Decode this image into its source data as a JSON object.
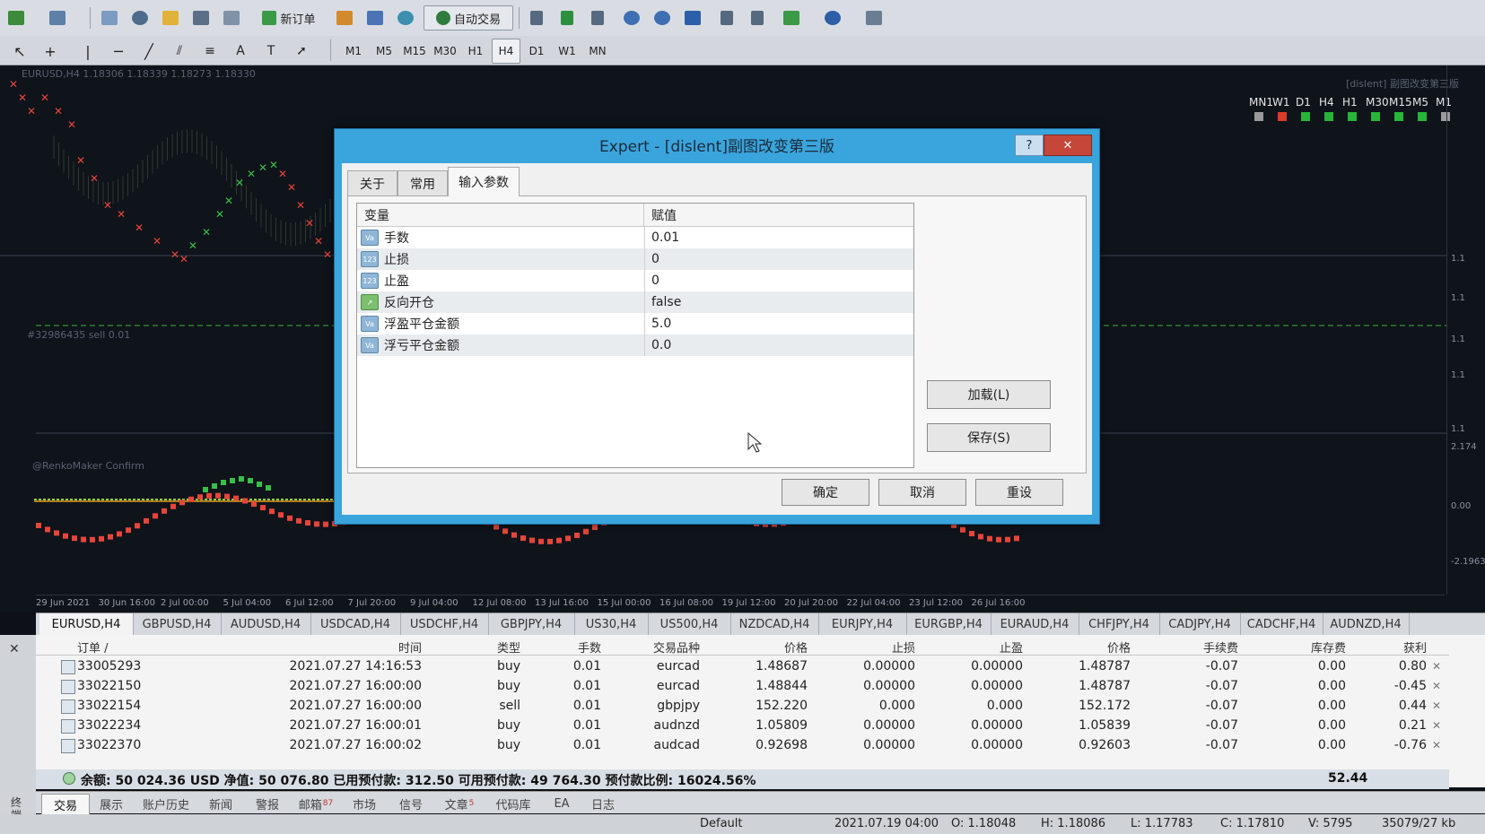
{
  "toolbar": {
    "new_order_label": "新订单",
    "auto_trading_label": "自动交易",
    "timeframes": [
      "M1",
      "M5",
      "M15",
      "M30",
      "H1",
      "H4",
      "D1",
      "W1",
      "MN"
    ],
    "active_timeframe": "H4"
  },
  "chart": {
    "info_line": "EURUSD,H4  1.18306 1.18339 1.18273 1.18330",
    "order_line_label": "#32986435 sell 0.01",
    "indicator_label": "@RenkoMaker Confirm",
    "top_right_label": "[dislent] 副图改变第三版",
    "tf_legend": [
      "MN1",
      "W1",
      "D1",
      "H4",
      "H1",
      "M30",
      "M15",
      "M5",
      "M1"
    ],
    "tf_legend_colors": [
      "#9a9a9a",
      "#d93a2b",
      "#27b43a",
      "#27b43a",
      "#27b43a",
      "#27b43a",
      "#27b43a",
      "#27b43a",
      "#9a9a9a"
    ],
    "x_labels": [
      "29 Jun 2021",
      "30 Jun 16:00",
      "2 Jul 00:00",
      "5 Jul 04:00",
      "6 Jul 12:00",
      "7 Jul 20:00",
      "9 Jul 04:00",
      "12 Jul 08:00",
      "13 Jul 16:00",
      "15 Jul 00:00",
      "16 Jul 08:00",
      "19 Jul 12:00",
      "20 Jul 20:00",
      "22 Jul 04:00",
      "23 Jul 12:00",
      "26 Jul 16:00"
    ],
    "price_labels": [
      "1.1",
      "1.1",
      "1.1",
      "1.1",
      "1.1",
      "2.174",
      "0.00",
      "-2.19635"
    ]
  },
  "dialog": {
    "title": "Expert - [dislent]副图改变第三版",
    "help": "?",
    "close": "✕",
    "tabs": [
      "关于",
      "常用",
      "输入参数"
    ],
    "selected_tab": "输入参数",
    "columns": [
      "变量",
      "赋值"
    ],
    "params": [
      {
        "icon": "Va",
        "name": "手数",
        "value": "0.01"
      },
      {
        "icon": "123",
        "name": "止损",
        "value": "0"
      },
      {
        "icon": "123",
        "name": "止盈",
        "value": "0"
      },
      {
        "icon": "bool",
        "name": "反向开仓",
        "value": "false"
      },
      {
        "icon": "Va",
        "name": "浮盈平仓金额",
        "value": "5.0"
      },
      {
        "icon": "Va",
        "name": "浮亏平仓金额",
        "value": "0.0"
      }
    ],
    "load_button": "加载(L)",
    "save_button": "保存(S)",
    "ok_button": "确定",
    "cancel_button": "取消",
    "reset_button": "重设"
  },
  "symbol_tabs": [
    "EURUSD,H4",
    "GBPUSD,H4",
    "AUDUSD,H4",
    "USDCAD,H4",
    "USDCHF,H4",
    "GBPJPY,H4",
    "US30,H4",
    "US500,H4",
    "NZDCAD,H4",
    "EURJPY,H4",
    "EURGBP,H4",
    "EURAUD,H4",
    "CHFJPY,H4",
    "CADJPY,H4",
    "CADCHF,H4",
    "AUDNZD,H4"
  ],
  "selected_symbol_tab": "EURUSD,H4",
  "terminal": {
    "headers": [
      "订单 /",
      "时间",
      "类型",
      "手数",
      "交易品种",
      "价格",
      "止损",
      "止盈",
      "价格",
      "手续费",
      "库存费",
      "获利"
    ],
    "orders": [
      {
        "ticket": "33005293",
        "time": "2021.07.27 14:16:53",
        "type": "buy",
        "lots": "0.01",
        "symbol": "eurcad",
        "price": "1.48687",
        "sl": "0.00000",
        "tp": "0.00000",
        "cur": "1.48787",
        "commission": "-0.07",
        "swap": "0.00",
        "profit": "0.80"
      },
      {
        "ticket": "33022150",
        "time": "2021.07.27 16:00:00",
        "type": "buy",
        "lots": "0.01",
        "symbol": "eurcad",
        "price": "1.48844",
        "sl": "0.00000",
        "tp": "0.00000",
        "cur": "1.48787",
        "commission": "-0.07",
        "swap": "0.00",
        "profit": "-0.45"
      },
      {
        "ticket": "33022154",
        "time": "2021.07.27 16:00:00",
        "type": "sell",
        "lots": "0.01",
        "symbol": "gbpjpy",
        "price": "152.220",
        "sl": "0.000",
        "tp": "0.000",
        "cur": "152.172",
        "commission": "-0.07",
        "swap": "0.00",
        "profit": "0.44"
      },
      {
        "ticket": "33022234",
        "time": "2021.07.27 16:00:01",
        "type": "buy",
        "lots": "0.01",
        "symbol": "audnzd",
        "price": "1.05809",
        "sl": "0.00000",
        "tp": "0.00000",
        "cur": "1.05839",
        "commission": "-0.07",
        "swap": "0.00",
        "profit": "0.21"
      },
      {
        "ticket": "33022370",
        "time": "2021.07.27 16:00:02",
        "type": "buy",
        "lots": "0.01",
        "symbol": "audcad",
        "price": "0.92698",
        "sl": "0.00000",
        "tp": "0.00000",
        "cur": "0.92603",
        "commission": "-0.07",
        "swap": "0.00",
        "profit": "-0.76"
      }
    ],
    "balance_line": "余额: 50 024.36 USD  净值: 50 076.80  已用预付款: 312.50  可用预付款: 49 764.30  预付款比例: 16024.56%",
    "total_profit": "52.44",
    "bottom_tabs": [
      "交易",
      "展示",
      "账户历史",
      "新闻",
      "警报",
      "邮箱",
      "市场",
      "信号",
      "文章",
      "代码库",
      "EA",
      "日志"
    ],
    "selected_bottom_tab": "交易",
    "mailbox_count": "87",
    "articles_count": "5",
    "side_label": "终端"
  },
  "statusbar": {
    "profile": "Default",
    "datetime": "2021.07.19 04:00",
    "open": "O: 1.18048",
    "high": "H: 1.18086",
    "low": "L: 1.17783",
    "close": "C: 1.17810",
    "volume": "V: 5795",
    "traffic": "35079/27 kb"
  }
}
